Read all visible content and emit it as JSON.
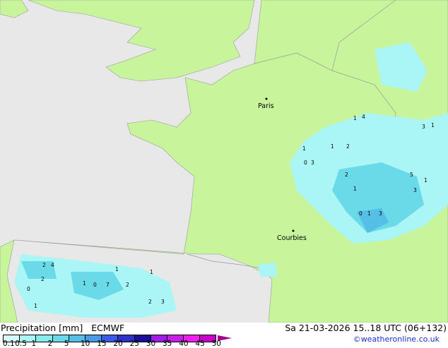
{
  "legend": {
    "title": "Precipitation [mm]",
    "model": "ECMWF",
    "datetime": "Sa 21-03-2026 15..18 UTC (06+132)",
    "credit": "©weatheronline.co.uk",
    "ticks": [
      "0.1",
      "0.5",
      "1",
      "2",
      "5",
      "10",
      "15",
      "20",
      "25",
      "30",
      "35",
      "40",
      "45",
      "50"
    ],
    "colors": [
      "#d6fafa",
      "#aaf5f5",
      "#87ebeb",
      "#6ad9e8",
      "#55bfe6",
      "#4b9ae6",
      "#3c5ae6",
      "#2d32c8",
      "#1a0f9b",
      "#a01ee6",
      "#c81ee6",
      "#f01ef0",
      "#c800c8"
    ]
  },
  "map": {
    "colors": {
      "sea": "#e8e8e8",
      "land": "#c8f59c",
      "border": "#999999",
      "precip_light": "#aaf5f5",
      "precip_med": "#6ad9e8"
    },
    "cities": [
      "Paris",
      "Courbies"
    ],
    "values": [
      "1",
      "0",
      "3",
      "1",
      "2",
      "1",
      "4",
      "3",
      "1",
      "2",
      "1",
      "0",
      "1",
      "3",
      "5",
      "3",
      "1",
      "2",
      "4",
      "1",
      "0",
      "7",
      "1",
      "2",
      "1",
      "2",
      "3",
      "0",
      "1",
      "2"
    ]
  }
}
